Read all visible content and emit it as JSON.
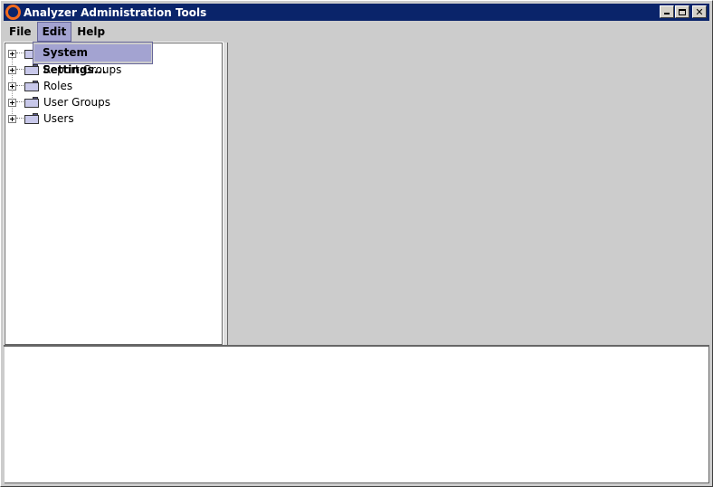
{
  "window": {
    "title": "Analyzer Administration Tools",
    "controls": [
      "minimize",
      "maximize",
      "close"
    ]
  },
  "menubar": {
    "items": [
      {
        "label": "File",
        "active": false
      },
      {
        "label": "Edit",
        "active": true
      },
      {
        "label": "Help",
        "active": false
      }
    ]
  },
  "dropdown": {
    "items": [
      {
        "label": "System Settings...",
        "highlighted": true
      }
    ]
  },
  "tree": {
    "items": [
      {
        "label": "",
        "icon": "folder-icon",
        "expandable": true
      },
      {
        "label": "Report Groups",
        "icon": "folder-icon",
        "expandable": true
      },
      {
        "label": "Roles",
        "icon": "folder-icon",
        "expandable": true
      },
      {
        "label": "User Groups",
        "icon": "folder-icon",
        "expandable": true
      },
      {
        "label": "Users",
        "icon": "folder-icon",
        "expandable": true
      }
    ]
  },
  "colors": {
    "titlebar": "#0a246a",
    "menu_highlight": "#a3a3d1",
    "app_icon": "#f36a1d",
    "panel_bg": "#cccccc"
  }
}
